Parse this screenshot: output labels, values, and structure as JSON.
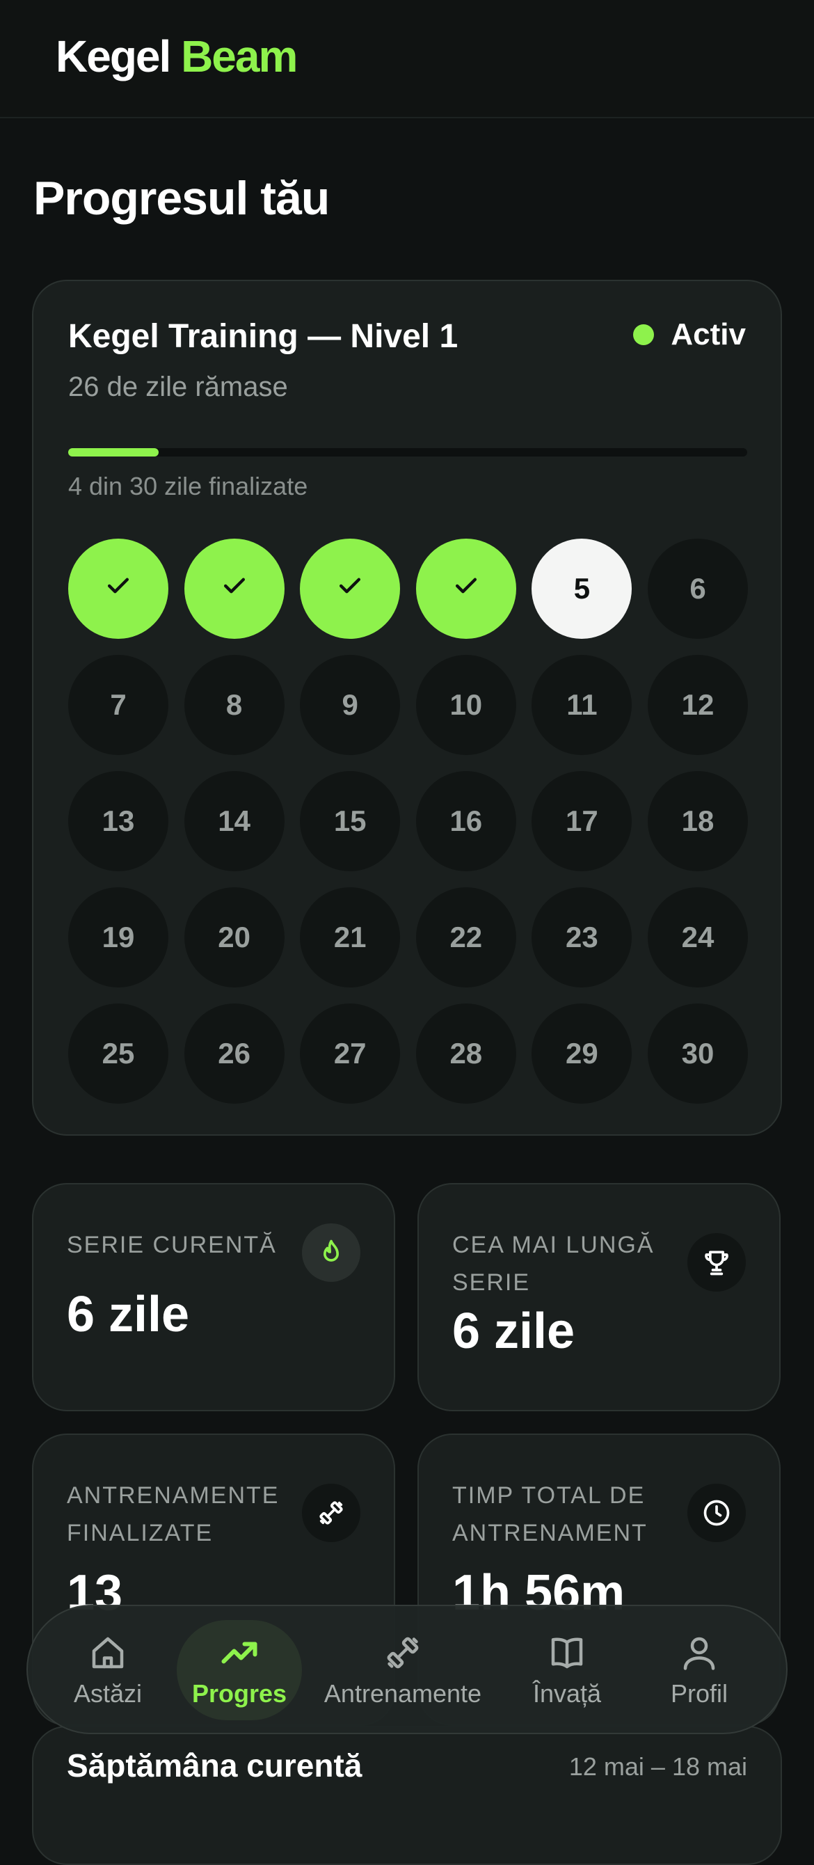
{
  "app": {
    "logo_part1": "Kegel",
    "logo_part2": "Beam"
  },
  "page_title": "Progresul tău",
  "program": {
    "title": "Kegel Training — Nivel 1",
    "remaining": "26 de zile rămase",
    "status": "Activ",
    "progress_text": "4 din 30 zile finalizate",
    "completed_days": 4,
    "total_days": 30,
    "progress_fraction": 0.133,
    "current_day": 5,
    "days": [
      "1",
      "2",
      "3",
      "4",
      "5",
      "6",
      "7",
      "8",
      "9",
      "10",
      "11",
      "12",
      "13",
      "14",
      "15",
      "16",
      "17",
      "18",
      "19",
      "20",
      "21",
      "22",
      "23",
      "24",
      "25",
      "26",
      "27",
      "28",
      "29",
      "30"
    ]
  },
  "stats": {
    "current_streak": {
      "label": "SERIE CURENTĂ",
      "value": "6 zile",
      "icon": "flame-icon"
    },
    "longest_streak": {
      "label": "CEA MAI LUNGĂ SERIE",
      "value": "6 zile",
      "icon": "trophy-icon"
    },
    "workouts_done": {
      "label": "ANTRENAMENTE FINALIZATE",
      "value": "13",
      "icon": "dumbbell-icon"
    },
    "total_time": {
      "label": "TIMP TOTAL DE ANTRENAMENT",
      "value": "1h 56m",
      "icon": "clock-icon"
    }
  },
  "next_section": {
    "title": "Săptămâna curentă",
    "right": "12 mai – 18 mai"
  },
  "tabs": [
    {
      "label": "Astăzi",
      "icon": "home-icon"
    },
    {
      "label": "Progres",
      "icon": "trend-up-icon"
    },
    {
      "label": "Antrenamente",
      "icon": "dumbbell-icon"
    },
    {
      "label": "Învață",
      "icon": "book-icon"
    },
    {
      "label": "Profil",
      "icon": "user-icon"
    }
  ],
  "colors": {
    "accent": "#8ef24c",
    "background": "#0f1212",
    "card": "#1a1f1e"
  }
}
